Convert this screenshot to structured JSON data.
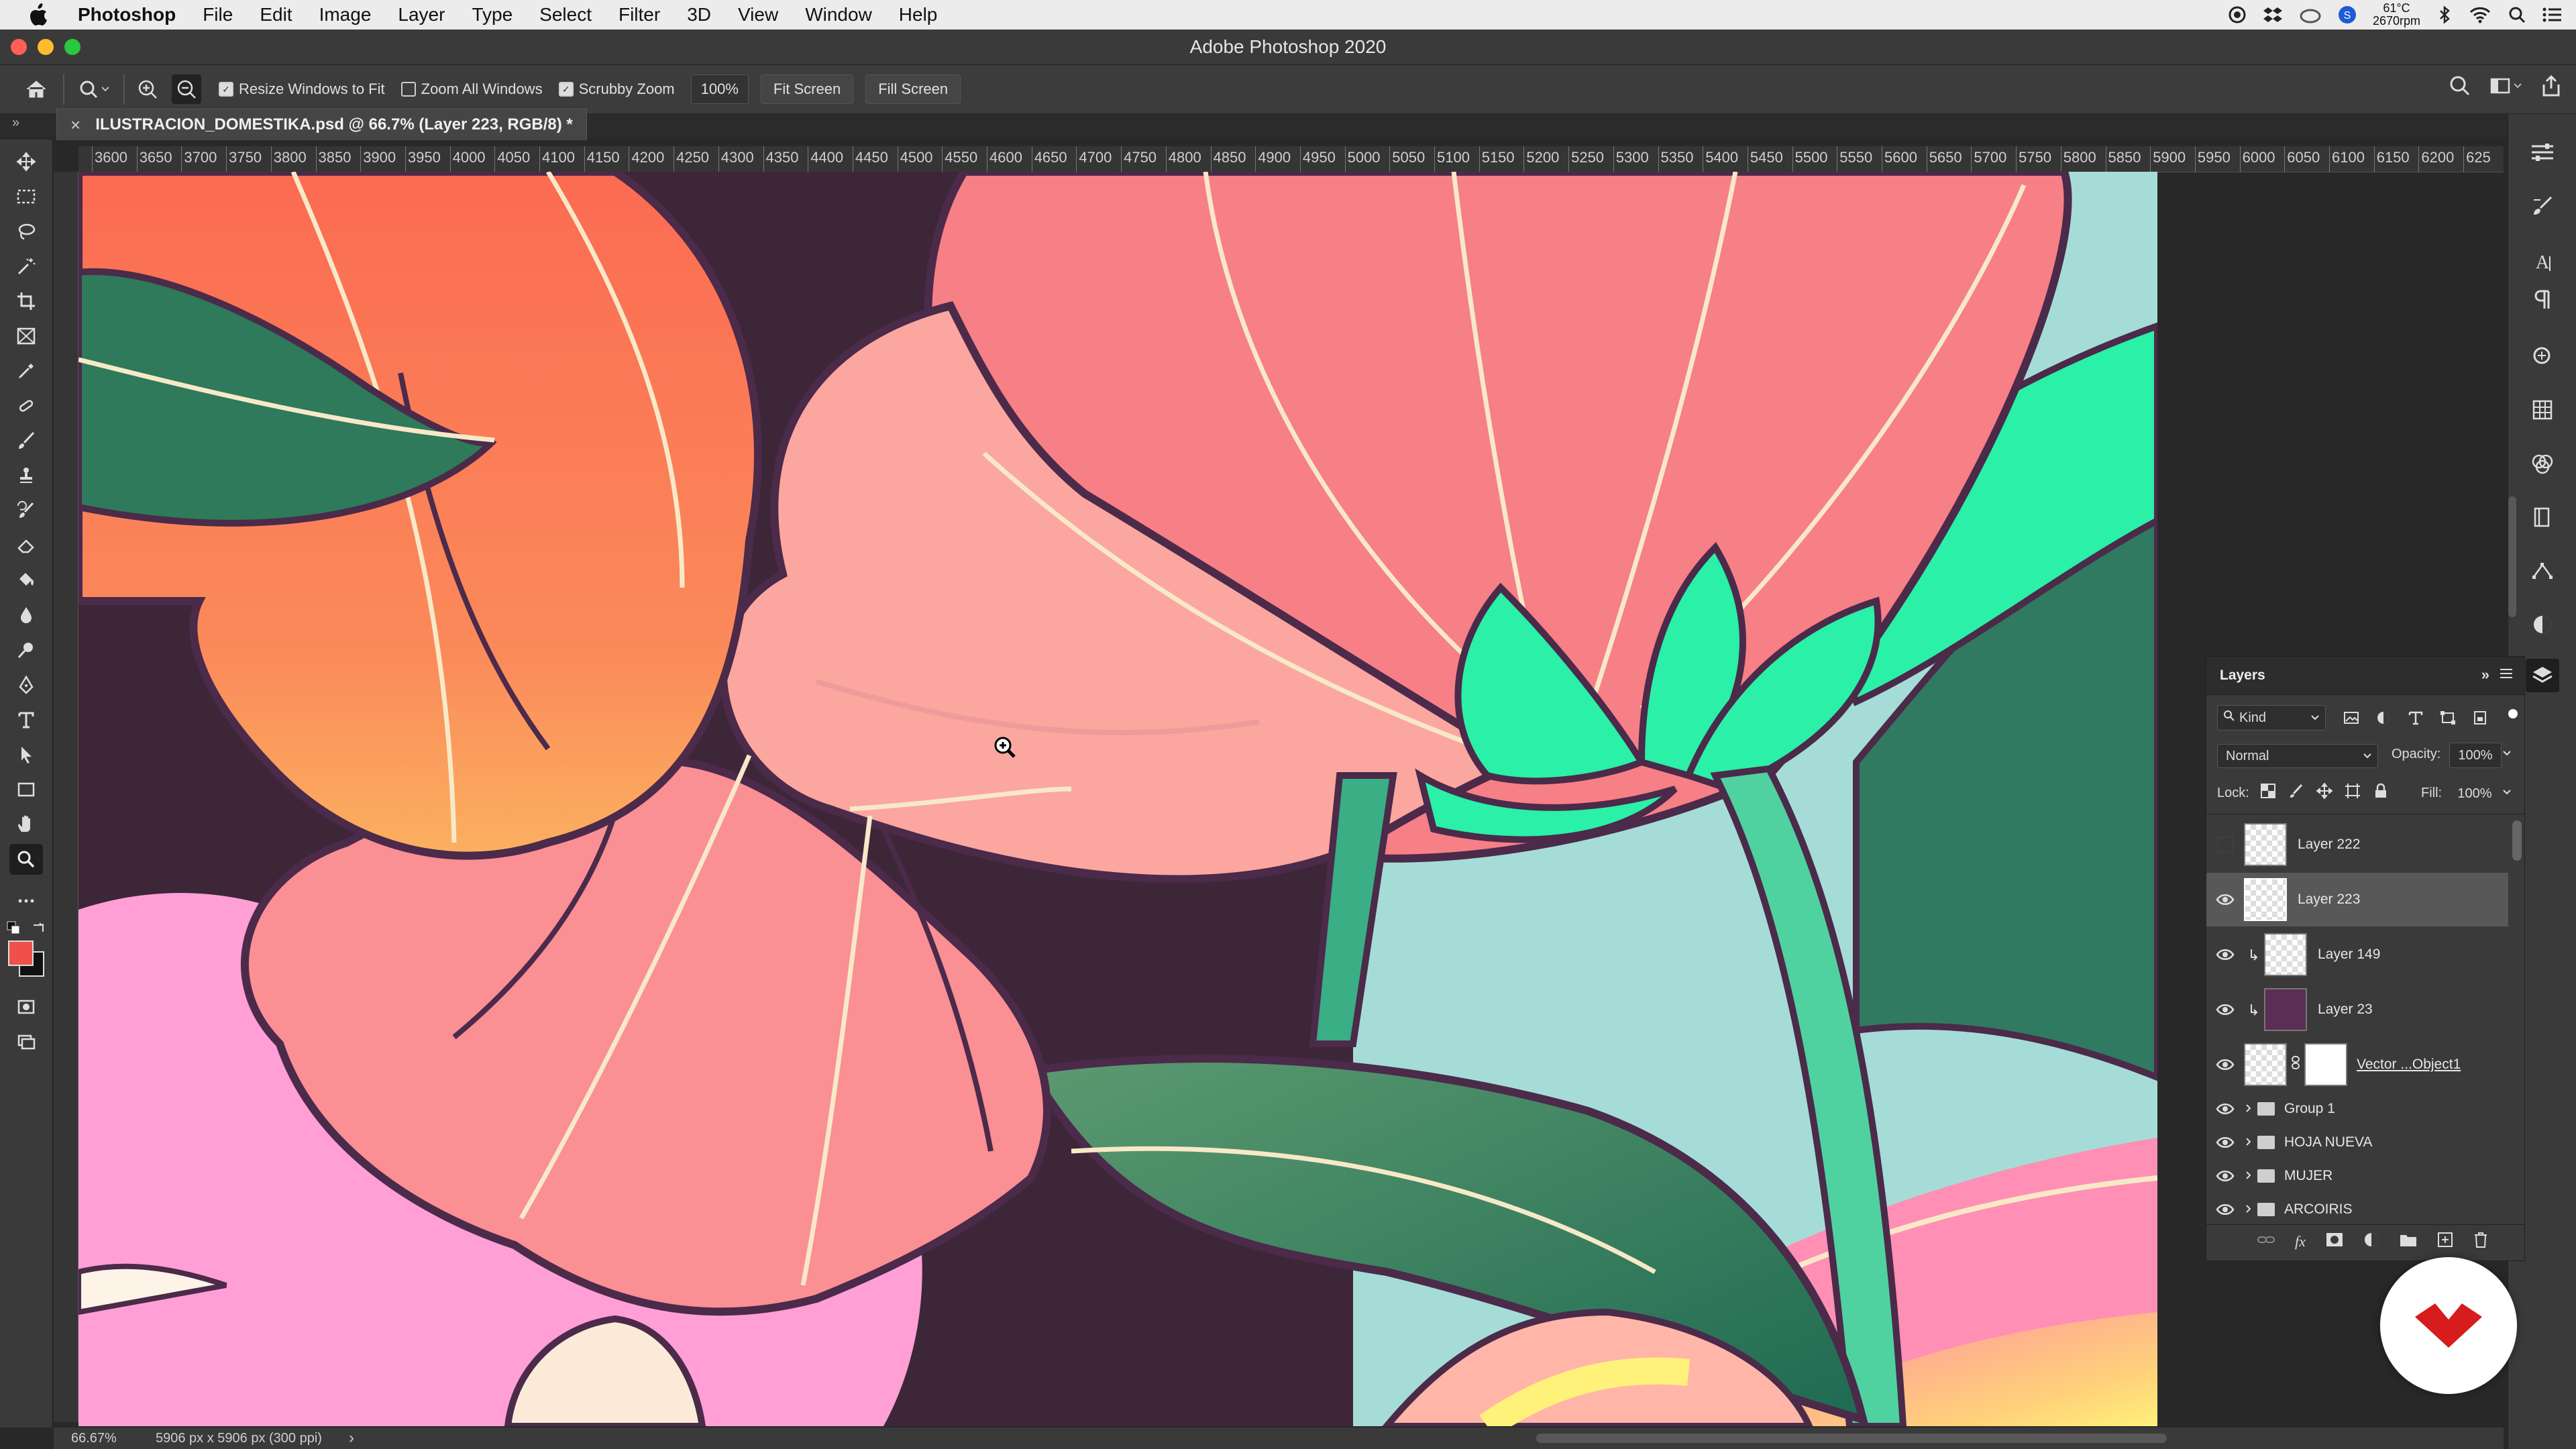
{
  "menubar": {
    "app_name": "Photoshop",
    "items": [
      "File",
      "Edit",
      "Image",
      "Layer",
      "Type",
      "Select",
      "Filter",
      "3D",
      "View",
      "Window",
      "Help"
    ],
    "temp": "61°C",
    "rpm": "2670rpm"
  },
  "window": {
    "title": "Adobe Photoshop 2020"
  },
  "options": {
    "resize_windows": "Resize Windows to Fit",
    "zoom_all": "Zoom All Windows",
    "scrubby": "Scrubby Zoom",
    "zoom_value": "100%",
    "fit_screen": "Fit Screen",
    "fill_screen": "Fill Screen",
    "resize_checked": true,
    "zoom_all_checked": false,
    "scrubby_checked": true
  },
  "document_tab": {
    "title": "ILUSTRACION_DOMESTIKA.psd @ 66.7% (Layer 223, RGB/8) *",
    "close": "×"
  },
  "ruler_labels": [
    "3600",
    "3650",
    "3700",
    "3750",
    "3800",
    "3850",
    "3900",
    "3950",
    "4000",
    "4050",
    "4100",
    "4150",
    "4200",
    "4250",
    "4300",
    "4350",
    "4400",
    "4450",
    "4500",
    "4550",
    "4600",
    "4650",
    "4700",
    "4750",
    "4800",
    "4850",
    "4900",
    "4950",
    "5000",
    "5050",
    "5100",
    "5150",
    "5200",
    "5250",
    "5300",
    "5350",
    "5400",
    "5450",
    "5500",
    "5550",
    "5600",
    "5650",
    "5700",
    "5750",
    "5800",
    "5850",
    "5900",
    "5950",
    "6000",
    "6050",
    "6100",
    "6150",
    "6200",
    "625"
  ],
  "layers_panel": {
    "title": "Layers",
    "filter_kind": "Kind",
    "blend_mode": "Normal",
    "opacity_label": "Opacity:",
    "opacity_value": "100%",
    "lock_label": "Lock:",
    "fill_label": "Fill:",
    "fill_value": "100%",
    "layers": [
      {
        "name": "Layer 222",
        "visible": false,
        "selected": false,
        "type": "pixel"
      },
      {
        "name": "Layer 223",
        "visible": true,
        "selected": true,
        "type": "pixel"
      },
      {
        "name": "Layer 149",
        "visible": true,
        "selected": false,
        "type": "clipped"
      },
      {
        "name": "Layer 23",
        "visible": true,
        "selected": false,
        "type": "clipped-purple"
      },
      {
        "name": "Vector ...Object1",
        "visible": true,
        "selected": false,
        "type": "masked"
      },
      {
        "name": "Group 1",
        "visible": true,
        "selected": false,
        "type": "group"
      },
      {
        "name": "HOJA NUEVA",
        "visible": true,
        "selected": false,
        "type": "group"
      },
      {
        "name": "MUJER",
        "visible": true,
        "selected": false,
        "type": "group"
      },
      {
        "name": "ARCOIRIS",
        "visible": true,
        "selected": false,
        "type": "group"
      }
    ]
  },
  "status": {
    "zoom": "66.67%",
    "doc_size": "5906 px x 5906 px (300 ppi)",
    "arrow": "›"
  },
  "colors": {
    "foreground": "#f0504a",
    "background": "#111111",
    "accent": "#d61c1c"
  }
}
